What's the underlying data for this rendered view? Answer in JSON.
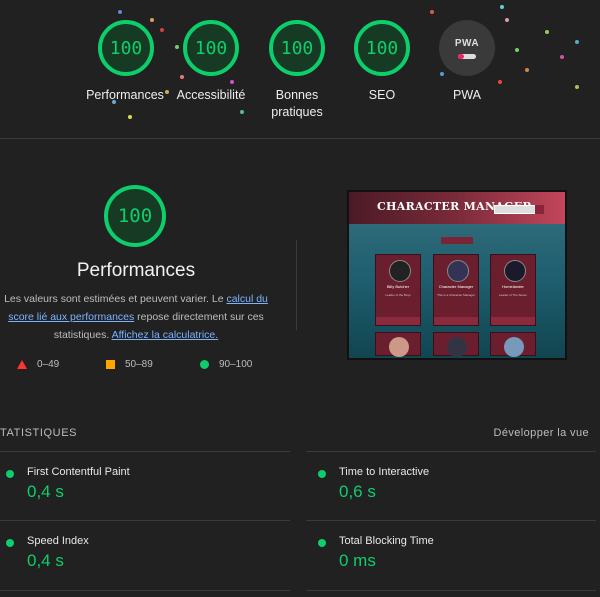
{
  "categories": [
    {
      "score": "100",
      "label": "Performances"
    },
    {
      "score": "100",
      "label": "Accessibilité"
    },
    {
      "score": "100",
      "label": "Bonnes pratiques"
    },
    {
      "score": "100",
      "label": "SEO"
    }
  ],
  "pwa": {
    "badge": "PWA",
    "label": "PWA"
  },
  "performance": {
    "score": "100",
    "title": "Performances",
    "desc_1": "Les valeurs sont estimées et peuvent varier. Le ",
    "link_1": "calcul du score lié aux performances",
    "desc_2": " repose directement sur ces statistiques. ",
    "link_2": "Affichez la calculatrice."
  },
  "legend": [
    {
      "range": "0–49",
      "icon": "triangle-icon",
      "color": "#ff3333"
    },
    {
      "range": "50–89",
      "icon": "square-icon",
      "color": "#ffa400"
    },
    {
      "range": "90–100",
      "icon": "circle-icon",
      "color": "#0cce6b"
    }
  ],
  "screenshot": {
    "brand": "CHARACTER MANAGER",
    "cards": [
      {
        "name": "Billy Butcher",
        "desc": "Leader of the Boys"
      },
      {
        "name": "Character Manager",
        "desc": "This is a Character Manager"
      },
      {
        "name": "Homelander",
        "desc": "Leader of The Seven"
      }
    ]
  },
  "stats": {
    "heading": "TATISTIQUES",
    "expand": "Développer la vue",
    "metrics": [
      {
        "name": "First Contentful Paint",
        "value": "0,4 s"
      },
      {
        "name": "Time to Interactive",
        "value": "0,6 s"
      },
      {
        "name": "Speed Index",
        "value": "0,4 s"
      },
      {
        "name": "Total Blocking Time",
        "value": "0 ms"
      }
    ]
  },
  "colors": {
    "pass": "#0cce6b",
    "background": "#212121",
    "link": "#7cb3ff"
  }
}
